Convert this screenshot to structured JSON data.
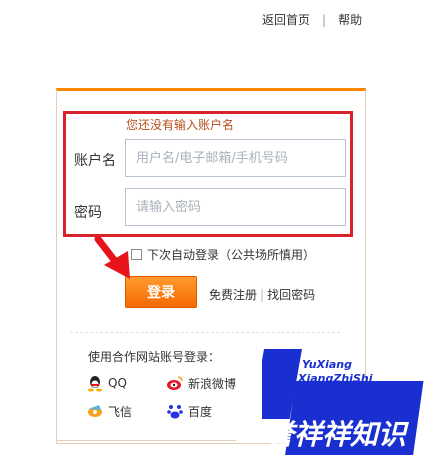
{
  "nav": {
    "home": "返回首页",
    "separator": "|",
    "help": "帮助"
  },
  "form": {
    "error": "您还没有输入账户名",
    "account_label": "账户名",
    "account_placeholder": "用户名/电子邮箱/手机号码",
    "password_label": "密码",
    "password_placeholder": "请输入密码",
    "remember": "下次自动登录（公共场所慎用）",
    "login": "登录",
    "register": "免费注册",
    "divider": "|",
    "forgot": "找回密码"
  },
  "partners": {
    "title": "使用合作网站账号登录：",
    "items": [
      {
        "label": "QQ",
        "icon": "qq-icon"
      },
      {
        "label": "新浪微博",
        "icon": "weibo-icon"
      },
      {
        "label": "飞信",
        "icon": "fetion-icon"
      },
      {
        "label": "百度",
        "icon": "baidu-icon"
      }
    ]
  },
  "watermark": {
    "line1": "YuXiang",
    "line2": "XiangZhiShi",
    "chars": "誉祥祥知识"
  },
  "colors": {
    "accent": "#ff8400",
    "error_box": "#d8232a",
    "watermark_blue": "#1a2fd0"
  }
}
